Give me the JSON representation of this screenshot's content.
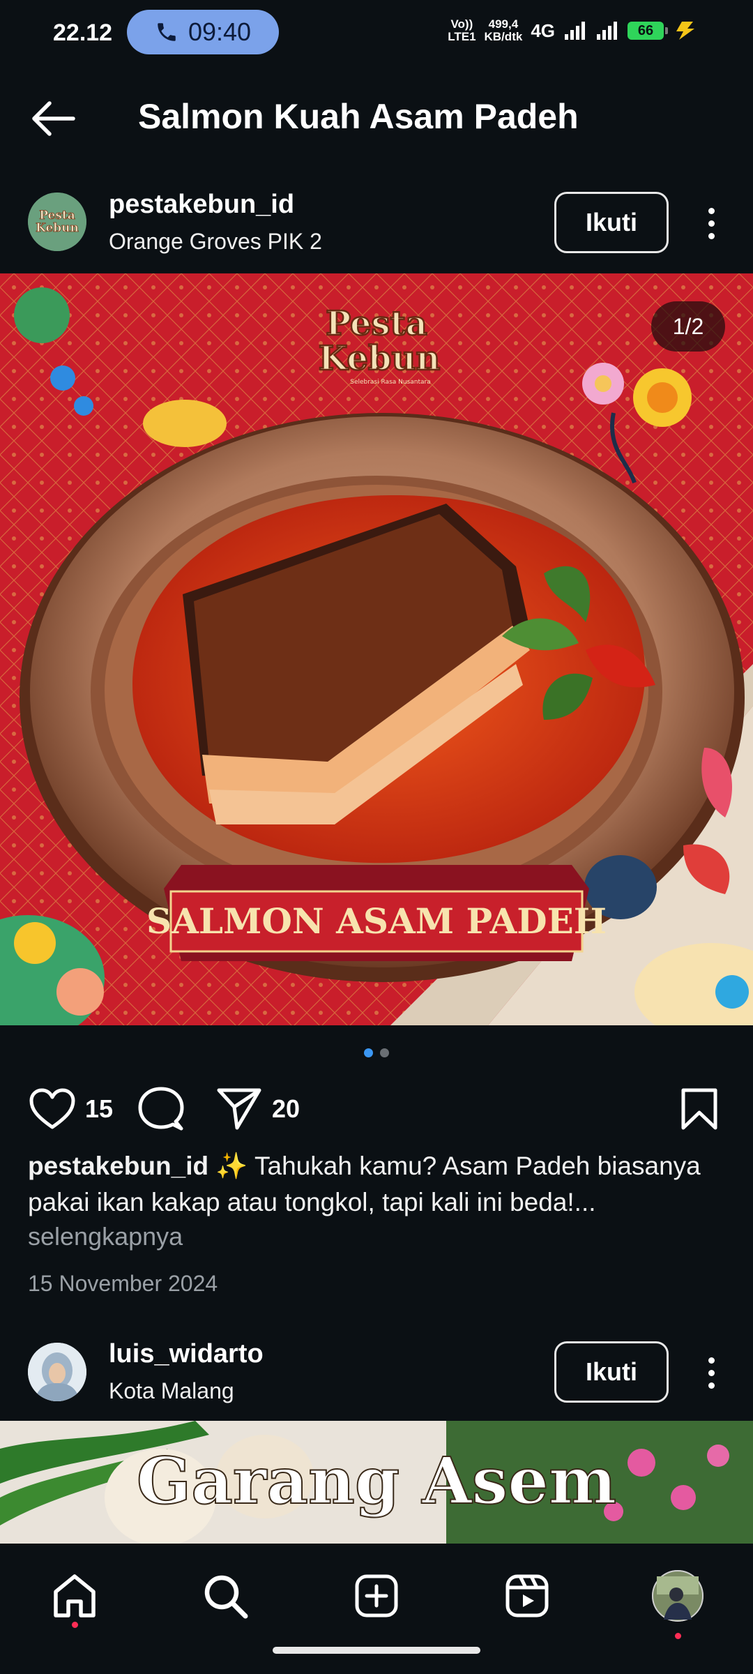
{
  "status_bar": {
    "time": "22.12",
    "call_time": "09:40",
    "volte_top": "Vo))",
    "volte_bottom": "LTE1",
    "speed_top": "499,4",
    "speed_bottom": "KB/dtk",
    "network": "4G",
    "battery": "66"
  },
  "header": {
    "title": "Salmon Kuah Asam Padeh"
  },
  "post1": {
    "username": "pestakebun_id",
    "location": "Orange Groves PIK 2",
    "follow_label": "Ikuti",
    "avatar_text_top": "Pesta",
    "avatar_text_bottom": "Kebun",
    "image": {
      "counter": "1/2",
      "logo_top": "Pesta",
      "logo_bottom": "Kebun",
      "logo_sub": "Selebrasi Rasa Nusantara",
      "banner": "SALMON ASAM PADEH"
    },
    "carousel": {
      "total": 2,
      "active": 1
    },
    "likes": "15",
    "shares": "20",
    "caption_user": "pestakebun_id",
    "caption_text": " ✨ Tahukah kamu? Asam Padeh biasanya pakai ikan kakap atau tongkol, tapi kali ini beda!...",
    "more_label": "selengkapnya",
    "date": "15 November 2024"
  },
  "post2": {
    "username": "luis_widarto",
    "location": "Kota Malang",
    "follow_label": "Ikuti",
    "image_title": "Garang Asem"
  },
  "nav": {
    "items": [
      "home-icon",
      "search-icon",
      "create-icon",
      "reels-icon",
      "profile-avatar"
    ]
  },
  "colors": {
    "background": "#0b1014",
    "call_pill": "#7ba2ea",
    "battery": "#2fd45a",
    "carousel_active": "#3b97f3",
    "notification": "#ff2d55"
  }
}
